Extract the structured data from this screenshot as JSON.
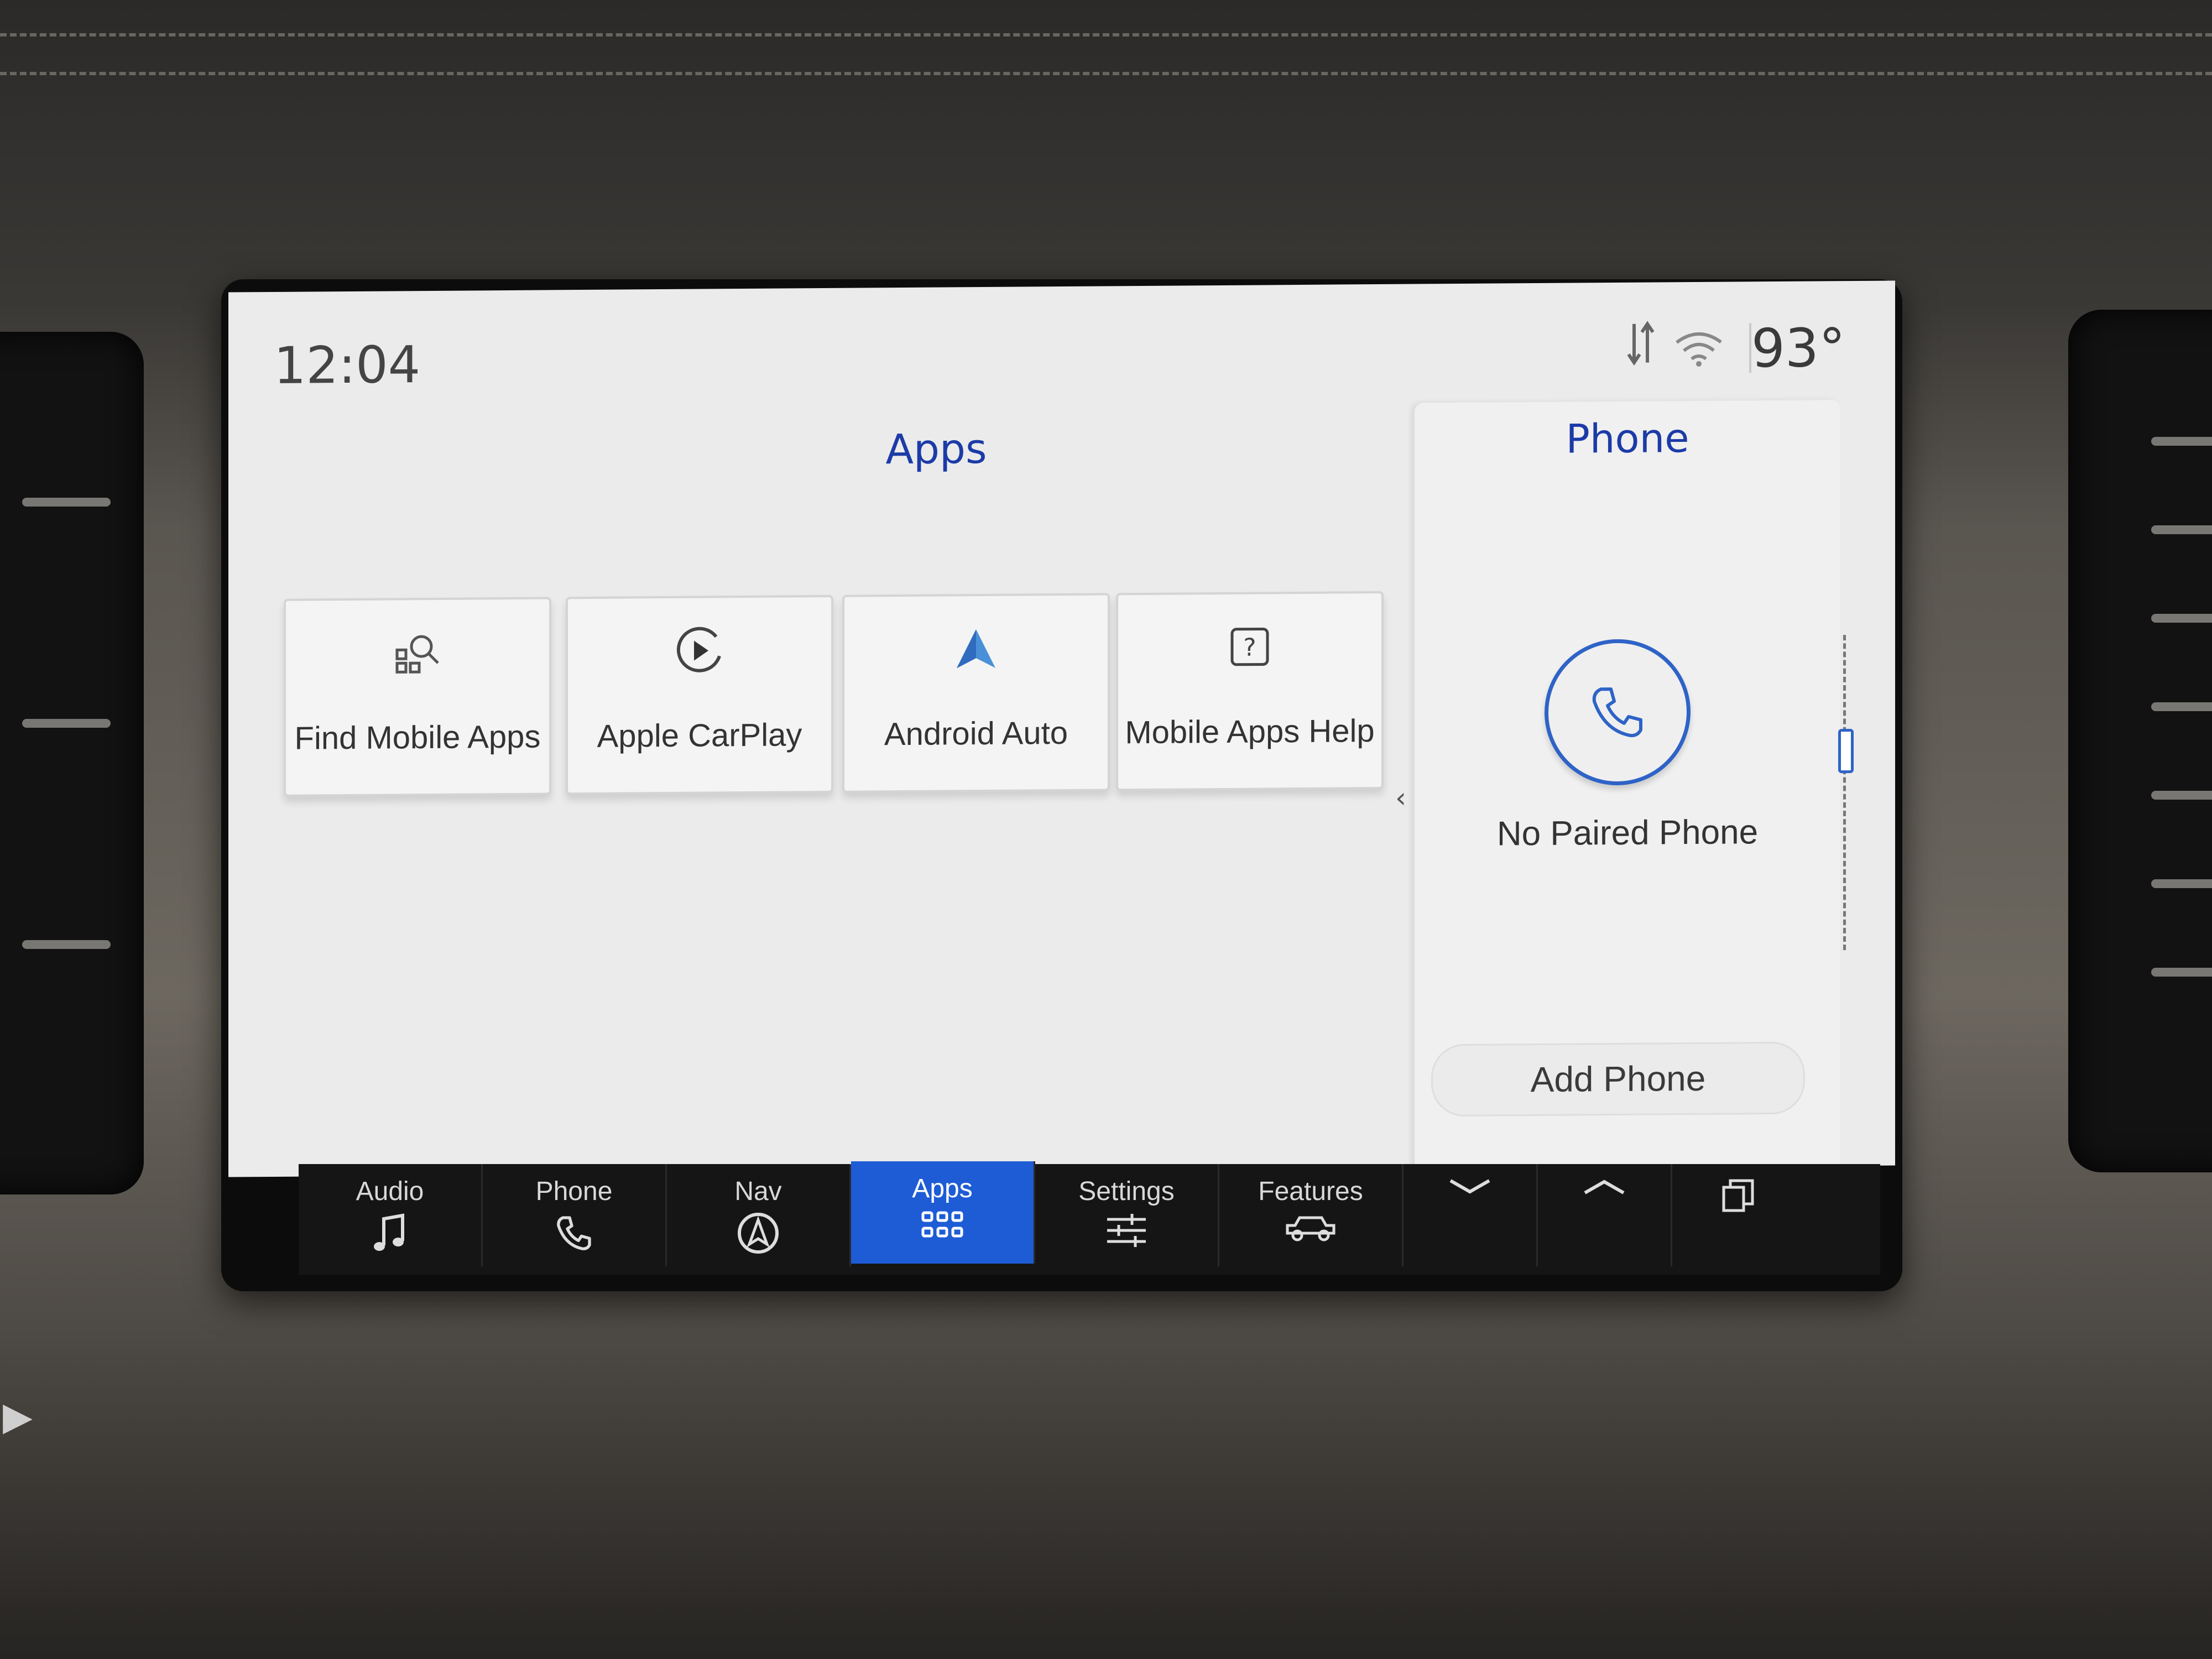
{
  "status_bar": {
    "time": "12:04",
    "temperature": "93°",
    "icons": [
      "data-transfer-icon",
      "wifi-icon"
    ]
  },
  "apps": {
    "title": "Apps",
    "tiles": [
      {
        "label": "Find Mobile Apps",
        "icon": "find-apps-icon"
      },
      {
        "label": "Apple CarPlay",
        "icon": "carplay-icon"
      },
      {
        "label": "Android Auto",
        "icon": "android-auto-icon"
      },
      {
        "label": "Mobile Apps Help",
        "icon": "help-icon"
      }
    ]
  },
  "phone_panel": {
    "title": "Phone",
    "status": "No Paired Phone",
    "add_button": "Add Phone"
  },
  "nav": {
    "items": [
      {
        "label": "Audio",
        "icon": "music-note-icon"
      },
      {
        "label": "Phone",
        "icon": "phone-icon"
      },
      {
        "label": "Nav",
        "icon": "navigation-icon"
      },
      {
        "label": "Apps",
        "icon": "apps-grid-icon",
        "active": true
      },
      {
        "label": "Settings",
        "icon": "sliders-icon"
      },
      {
        "label": "Features",
        "icon": "vehicle-icon"
      },
      {
        "label": "",
        "icon": "chevron-down-icon"
      },
      {
        "label": "",
        "icon": "chevron-up-icon"
      },
      {
        "label": "",
        "icon": "window-stack-icon"
      }
    ]
  },
  "colors": {
    "accent": "#1c3ba8",
    "active_tab": "#1e5cd6",
    "screen_bg": "#ebebeb"
  }
}
